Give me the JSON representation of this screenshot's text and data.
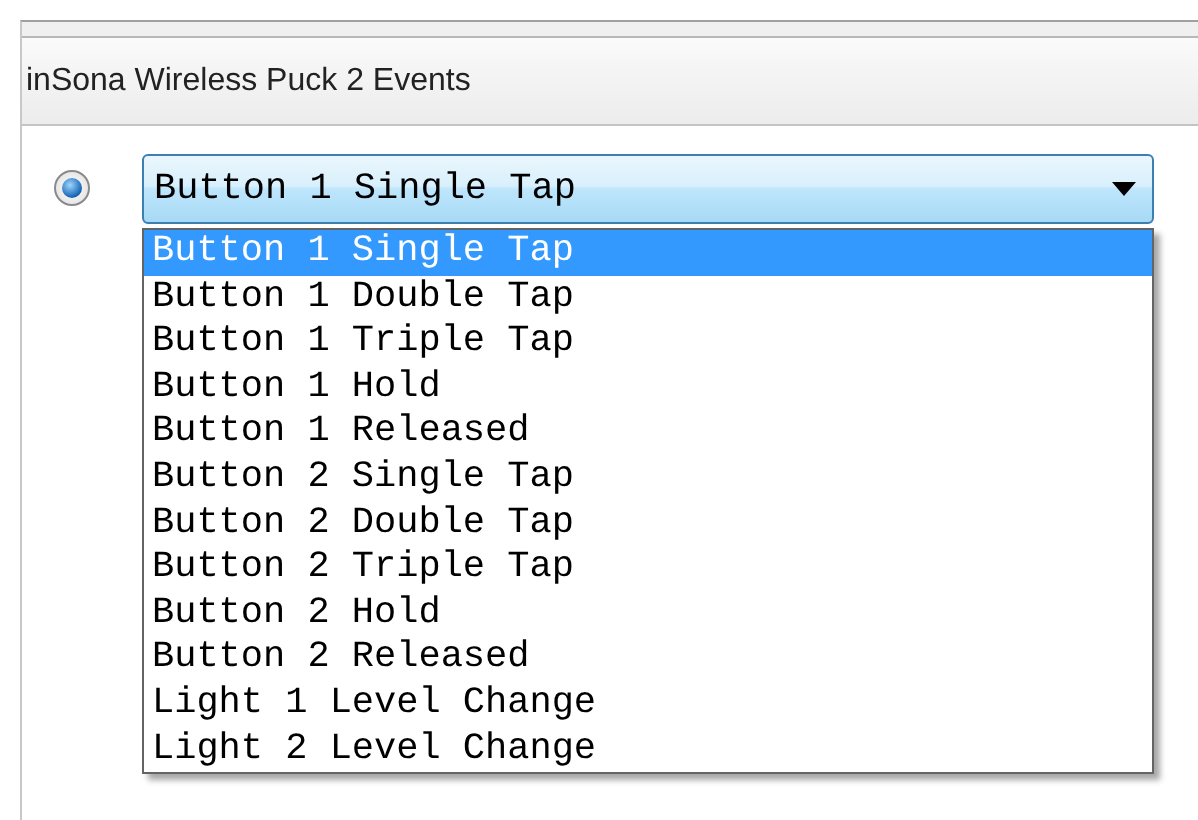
{
  "section": {
    "title": "inSona Wireless Puck 2 Events"
  },
  "radio": {
    "checked": true
  },
  "dropdown": {
    "value": "Button 1 Single Tap",
    "expanded": true,
    "options": [
      {
        "label": "Button 1 Single Tap",
        "selected": true
      },
      {
        "label": "Button 1 Double Tap",
        "selected": false
      },
      {
        "label": "Button 1 Triple Tap",
        "selected": false
      },
      {
        "label": "Button 1 Hold",
        "selected": false
      },
      {
        "label": "Button 1 Released",
        "selected": false
      },
      {
        "label": "Button 2 Single Tap",
        "selected": false
      },
      {
        "label": "Button 2 Double Tap",
        "selected": false
      },
      {
        "label": "Button 2 Triple Tap",
        "selected": false
      },
      {
        "label": "Button 2 Hold",
        "selected": false
      },
      {
        "label": "Button 2 Released",
        "selected": false
      },
      {
        "label": "Light 1 Level Change",
        "selected": false
      },
      {
        "label": "Light 2 Level Change",
        "selected": false
      }
    ]
  }
}
